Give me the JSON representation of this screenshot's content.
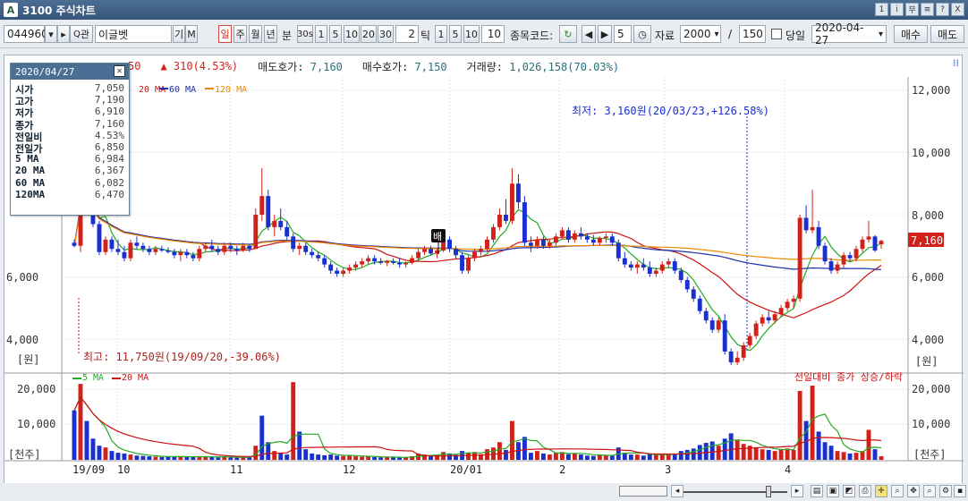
{
  "window": {
    "title": "3100 주식차트",
    "logo": "A",
    "buttons": [
      "1",
      "i",
      "무",
      "≡",
      "?",
      "X"
    ]
  },
  "toolbar": {
    "code": "044960",
    "search_icon": "Q",
    "search_label": "관",
    "stock_name": "이글벳",
    "btn_gi": "기",
    "btn_m": "M",
    "period_buttons": [
      "일",
      "주",
      "월",
      "년"
    ],
    "minute_label": "분",
    "minute_buttons": [
      "30s",
      "1",
      "5",
      "10",
      "20",
      "30"
    ],
    "tick_value": "2",
    "tick_label": "틱",
    "tick_buttons": [
      "1",
      "5",
      "10"
    ],
    "tick_count": "10",
    "code_label": "종목코드:",
    "spin_value": "5",
    "data_label": "자료",
    "data_count": "2000",
    "slash": "/",
    "view_count": "150",
    "today_label": "당일",
    "date": "2020-04-27",
    "buy_label": "매수",
    "sell_label": "매도"
  },
  "info": {
    "price_partial": "50",
    "change": "▲ 310(4.53%)",
    "ask_label": "매도호가:",
    "ask_value": "7,160",
    "bid_label": "매수호가:",
    "bid_value": "7,150",
    "volume_label": "거래량:",
    "volume_value": "1,026,158(70.03%)"
  },
  "ma_legend": [
    {
      "label": "20 MA",
      "color": "#cc1111"
    },
    {
      "label": "60 MA",
      "color": "#1a2fa8"
    },
    {
      "label": "120 MA",
      "color": "#f08a00"
    }
  ],
  "vol_legend": [
    {
      "label": "5 MA",
      "color": "#22aa22"
    },
    {
      "label": "20 MA",
      "color": "#cc1111"
    }
  ],
  "vol_note": "전일대비 종가 상승/하락",
  "price_axis_labels": [
    "12,000",
    "10,000",
    "8,000",
    "6,000",
    "4,000"
  ],
  "price_unit": "[원]",
  "volume_axis_labels": [
    "20,000",
    "10,000"
  ],
  "volume_unit": "[천주]",
  "current_price_tag": "7,160",
  "annotations": {
    "low": "최저: 3,160원(20/03/23,+126.58%)",
    "high": "최고: 11,750원(19/09/20,-39.06%)",
    "marker": "배"
  },
  "x_labels": [
    "19/09",
    "10",
    "11",
    "12",
    "20/01",
    "2",
    "3",
    "4"
  ],
  "popup": {
    "date": "2020/04/27",
    "rows": [
      {
        "k": "시가",
        "v": "7,050"
      },
      {
        "k": "고가",
        "v": "7,190"
      },
      {
        "k": "저가",
        "v": "6,910"
      },
      {
        "k": "종가",
        "v": "7,160"
      },
      {
        "k": "전일비",
        "v": "4.53%"
      },
      {
        "k": "전일가",
        "v": "6,850"
      },
      {
        "k": "5  MA",
        "v": "6,984"
      },
      {
        "k": "20 MA",
        "v": "6,367"
      },
      {
        "k": "60 MA",
        "v": "6,082"
      },
      {
        "k": "120MA",
        "v": "6,470"
      }
    ]
  },
  "colors": {
    "up": "#d0221a",
    "down": "#1a2fd0",
    "ma5": "#22aa22",
    "ma20": "#cc1111",
    "ma60": "#1a2fa8",
    "ma120": "#f08a00"
  },
  "chart_data": {
    "type": "candlestick",
    "price_axis": [
      4000,
      12000
    ],
    "volume_axis_ticks": [
      10000,
      20000
    ],
    "current_price": 7160,
    "candles": [
      [
        7100,
        7200,
        6950,
        7000
      ],
      [
        7000,
        11750,
        6800,
        9500
      ],
      [
        9200,
        9400,
        8300,
        8500
      ],
      [
        8500,
        8700,
        7600,
        7700
      ],
      [
        7700,
        7800,
        6700,
        6800
      ],
      [
        6800,
        7300,
        6700,
        7200
      ],
      [
        7200,
        7300,
        6800,
        6900
      ],
      [
        6900,
        7200,
        6700,
        6800
      ],
      [
        6800,
        7000,
        6500,
        6600
      ],
      [
        6600,
        7200,
        6500,
        7100
      ],
      [
        7100,
        7300,
        6900,
        7000
      ],
      [
        7000,
        7100,
        6800,
        6900
      ],
      [
        6900,
        7000,
        6700,
        6800
      ],
      [
        6800,
        7000,
        6700,
        6900
      ],
      [
        6900,
        7000,
        6800,
        6850
      ],
      [
        6850,
        6950,
        6750,
        6800
      ],
      [
        6800,
        6900,
        6600,
        6700
      ],
      [
        6700,
        6900,
        6500,
        6800
      ],
      [
        6800,
        6900,
        6600,
        6700
      ],
      [
        6700,
        6800,
        6500,
        6600
      ],
      [
        6600,
        7000,
        6500,
        6900
      ],
      [
        6900,
        7100,
        6800,
        7000
      ],
      [
        7000,
        7200,
        6800,
        6900
      ],
      [
        6900,
        7000,
        6700,
        6800
      ],
      [
        6800,
        7100,
        6700,
        7000
      ],
      [
        7000,
        7100,
        6800,
        6900
      ],
      [
        6900,
        7000,
        6700,
        6850
      ],
      [
        6850,
        7100,
        6800,
        7000
      ],
      [
        7000,
        7050,
        6800,
        6900
      ],
      [
        6900,
        8200,
        6900,
        8000
      ],
      [
        8000,
        9500,
        7800,
        8600
      ],
      [
        8600,
        8800,
        7500,
        7600
      ],
      [
        7600,
        8000,
        7300,
        7800
      ],
      [
        7800,
        8200,
        7500,
        7600
      ],
      [
        7600,
        7800,
        7200,
        7300
      ],
      [
        7300,
        7400,
        6800,
        6900
      ],
      [
        6900,
        7100,
        6700,
        7000
      ],
      [
        7000,
        7100,
        6700,
        6800
      ],
      [
        6800,
        6900,
        6600,
        6700
      ],
      [
        6700,
        6800,
        6500,
        6600
      ],
      [
        6600,
        6700,
        6300,
        6400
      ],
      [
        6400,
        6500,
        6100,
        6200
      ],
      [
        6200,
        6300,
        6000,
        6100
      ],
      [
        6100,
        6300,
        6000,
        6200
      ],
      [
        6200,
        6400,
        6100,
        6300
      ],
      [
        6300,
        6500,
        6200,
        6400
      ],
      [
        6400,
        6600,
        6300,
        6500
      ],
      [
        6500,
        6700,
        6400,
        6600
      ],
      [
        6600,
        6700,
        6400,
        6500
      ],
      [
        6500,
        6600,
        6400,
        6450
      ],
      [
        6450,
        6550,
        6350,
        6500
      ],
      [
        6500,
        6600,
        6400,
        6450
      ],
      [
        6450,
        6600,
        6300,
        6400
      ],
      [
        6400,
        6500,
        6300,
        6450
      ],
      [
        6450,
        6700,
        6400,
        6600
      ],
      [
        6600,
        6900,
        6500,
        6800
      ],
      [
        6800,
        7000,
        6700,
        6900
      ],
      [
        6900,
        7000,
        6700,
        6750
      ],
      [
        6750,
        6900,
        6600,
        6850
      ],
      [
        6850,
        7300,
        6800,
        7200
      ],
      [
        7200,
        7300,
        6800,
        6900
      ],
      [
        6900,
        7000,
        6600,
        6700
      ],
      [
        6700,
        6800,
        6100,
        6200
      ],
      [
        6200,
        6700,
        6100,
        6600
      ],
      [
        6600,
        6900,
        6500,
        6800
      ],
      [
        6800,
        7000,
        6700,
        6900
      ],
      [
        6900,
        7300,
        6800,
        7200
      ],
      [
        7200,
        7700,
        7100,
        7600
      ],
      [
        7600,
        8200,
        7500,
        8000
      ],
      [
        8000,
        8500,
        7700,
        7800
      ],
      [
        7800,
        9500,
        7700,
        9000
      ],
      [
        9000,
        9300,
        8200,
        8400
      ],
      [
        8400,
        8600,
        7000,
        7100
      ],
      [
        7100,
        7300,
        6800,
        7000
      ],
      [
        7000,
        7300,
        6900,
        7200
      ],
      [
        7200,
        7300,
        6900,
        7000
      ],
      [
        7000,
        7200,
        6900,
        7100
      ],
      [
        7100,
        7400,
        7000,
        7300
      ],
      [
        7300,
        7600,
        7200,
        7500
      ],
      [
        7500,
        7600,
        7100,
        7200
      ],
      [
        7200,
        7500,
        7100,
        7400
      ],
      [
        7400,
        7600,
        7200,
        7300
      ],
      [
        7300,
        7400,
        7100,
        7200
      ],
      [
        7200,
        7350,
        7000,
        7100
      ],
      [
        7100,
        7300,
        7000,
        7250
      ],
      [
        7250,
        7400,
        7100,
        7300
      ],
      [
        7300,
        7400,
        7000,
        7100
      ],
      [
        7100,
        7200,
        6500,
        6600
      ],
      [
        6600,
        6800,
        6300,
        6400
      ],
      [
        6400,
        6500,
        6200,
        6300
      ],
      [
        6300,
        6500,
        6100,
        6400
      ],
      [
        6400,
        6600,
        6200,
        6300
      ],
      [
        6300,
        6500,
        6000,
        6100
      ],
      [
        6100,
        6300,
        6000,
        6200
      ],
      [
        6200,
        6500,
        6100,
        6400
      ],
      [
        6400,
        6600,
        6300,
        6500
      ],
      [
        6500,
        6600,
        6100,
        6200
      ],
      [
        6200,
        6300,
        5800,
        5900
      ],
      [
        5900,
        6000,
        5500,
        5600
      ],
      [
        5600,
        5700,
        5200,
        5300
      ],
      [
        5300,
        5400,
        4800,
        4900
      ],
      [
        4900,
        5000,
        4500,
        4600
      ],
      [
        4600,
        4700,
        4200,
        4300
      ],
      [
        4300,
        4700,
        4200,
        4600
      ],
      [
        4600,
        4800,
        3500,
        3600
      ],
      [
        3600,
        3700,
        3160,
        3250
      ],
      [
        3250,
        3600,
        3160,
        3400
      ],
      [
        3400,
        3900,
        3300,
        3800
      ],
      [
        3800,
        4200,
        3700,
        4100
      ],
      [
        4100,
        4600,
        4000,
        4500
      ],
      [
        4500,
        4800,
        4400,
        4700
      ],
      [
        4700,
        4900,
        4500,
        4600
      ],
      [
        4600,
        4900,
        4500,
        4800
      ],
      [
        4800,
        5100,
        4700,
        5000
      ],
      [
        5000,
        5300,
        4900,
        5200
      ],
      [
        5200,
        5400,
        5000,
        5300
      ],
      [
        5300,
        8000,
        5200,
        7900
      ],
      [
        7900,
        8300,
        7400,
        7500
      ],
      [
        7500,
        8800,
        7400,
        7600
      ],
      [
        7600,
        7800,
        6900,
        7000
      ],
      [
        7000,
        7100,
        6400,
        6500
      ],
      [
        6500,
        6600,
        6100,
        6200
      ],
      [
        6200,
        6500,
        6100,
        6400
      ],
      [
        6400,
        6800,
        6300,
        6700
      ],
      [
        6700,
        6800,
        6500,
        6600
      ],
      [
        6600,
        7000,
        6500,
        6900
      ],
      [
        6900,
        7300,
        6800,
        7200
      ],
      [
        7200,
        7800,
        7100,
        7300
      ],
      [
        7300,
        7350,
        6800,
        6850
      ],
      [
        7050,
        7190,
        6910,
        7160
      ]
    ],
    "volumes": [
      [
        14000,
        -1
      ],
      [
        21500,
        1
      ],
      [
        11000,
        -1
      ],
      [
        6000,
        -1
      ],
      [
        4000,
        -1
      ],
      [
        3500,
        1
      ],
      [
        2500,
        -1
      ],
      [
        2000,
        -1
      ],
      [
        1800,
        -1
      ],
      [
        1500,
        1
      ],
      [
        1200,
        -1
      ],
      [
        1100,
        -1
      ],
      [
        1000,
        -1
      ],
      [
        900,
        1
      ],
      [
        800,
        -1
      ],
      [
        900,
        -1
      ],
      [
        1000,
        -1
      ],
      [
        900,
        1
      ],
      [
        800,
        -1
      ],
      [
        800,
        -1
      ],
      [
        900,
        1
      ],
      [
        1000,
        1
      ],
      [
        800,
        -1
      ],
      [
        700,
        -1
      ],
      [
        900,
        1
      ],
      [
        700,
        -1
      ],
      [
        600,
        -1
      ],
      [
        800,
        1
      ],
      [
        700,
        -1
      ],
      [
        4000,
        1
      ],
      [
        12500,
        -1
      ],
      [
        5000,
        -1
      ],
      [
        2500,
        1
      ],
      [
        2000,
        -1
      ],
      [
        1500,
        -1
      ],
      [
        22000,
        1
      ],
      [
        8000,
        -1
      ],
      [
        3000,
        -1
      ],
      [
        1800,
        -1
      ],
      [
        1500,
        -1
      ],
      [
        1300,
        -1
      ],
      [
        1500,
        -1
      ],
      [
        1200,
        -1
      ],
      [
        1100,
        1
      ],
      [
        1200,
        1
      ],
      [
        1000,
        1
      ],
      [
        900,
        1
      ],
      [
        900,
        1
      ],
      [
        800,
        -1
      ],
      [
        700,
        -1
      ],
      [
        800,
        1
      ],
      [
        700,
        -1
      ],
      [
        700,
        -1
      ],
      [
        700,
        1
      ],
      [
        1000,
        1
      ],
      [
        1800,
        1
      ],
      [
        1500,
        1
      ],
      [
        1200,
        -1
      ],
      [
        1300,
        1
      ],
      [
        2200,
        1
      ],
      [
        1800,
        -1
      ],
      [
        1400,
        -1
      ],
      [
        2500,
        -1
      ],
      [
        2000,
        1
      ],
      [
        2200,
        1
      ],
      [
        1600,
        1
      ],
      [
        3000,
        1
      ],
      [
        3500,
        1
      ],
      [
        5000,
        1
      ],
      [
        2800,
        -1
      ],
      [
        11000,
        1
      ],
      [
        5000,
        -1
      ],
      [
        6500,
        -1
      ],
      [
        2000,
        -1
      ],
      [
        2500,
        1
      ],
      [
        1800,
        -1
      ],
      [
        1500,
        1
      ],
      [
        2000,
        1
      ],
      [
        2200,
        1
      ],
      [
        1600,
        -1
      ],
      [
        1800,
        1
      ],
      [
        1500,
        -1
      ],
      [
        1200,
        -1
      ],
      [
        1100,
        -1
      ],
      [
        1300,
        1
      ],
      [
        1400,
        1
      ],
      [
        1200,
        -1
      ],
      [
        3500,
        -1
      ],
      [
        2000,
        -1
      ],
      [
        1500,
        -1
      ],
      [
        1500,
        1
      ],
      [
        1200,
        -1
      ],
      [
        1800,
        -1
      ],
      [
        1400,
        1
      ],
      [
        1500,
        1
      ],
      [
        1600,
        1
      ],
      [
        1500,
        -1
      ],
      [
        2500,
        -1
      ],
      [
        2800,
        -1
      ],
      [
        3200,
        -1
      ],
      [
        4200,
        -1
      ],
      [
        4800,
        -1
      ],
      [
        5200,
        -1
      ],
      [
        4000,
        1
      ],
      [
        6000,
        -1
      ],
      [
        7500,
        -1
      ],
      [
        5500,
        1
      ],
      [
        4500,
        1
      ],
      [
        4000,
        1
      ],
      [
        3500,
        1
      ],
      [
        3000,
        1
      ],
      [
        2800,
        -1
      ],
      [
        2500,
        1
      ],
      [
        3000,
        1
      ],
      [
        3200,
        1
      ],
      [
        2800,
        1
      ],
      [
        19500,
        1
      ],
      [
        11000,
        -1
      ],
      [
        21000,
        1
      ],
      [
        8000,
        -1
      ],
      [
        5000,
        -1
      ],
      [
        4000,
        -1
      ],
      [
        2500,
        1
      ],
      [
        2200,
        1
      ],
      [
        1800,
        -1
      ],
      [
        2000,
        1
      ],
      [
        2500,
        1
      ],
      [
        8500,
        1
      ],
      [
        3000,
        -1
      ],
      [
        1026,
        1
      ]
    ]
  }
}
